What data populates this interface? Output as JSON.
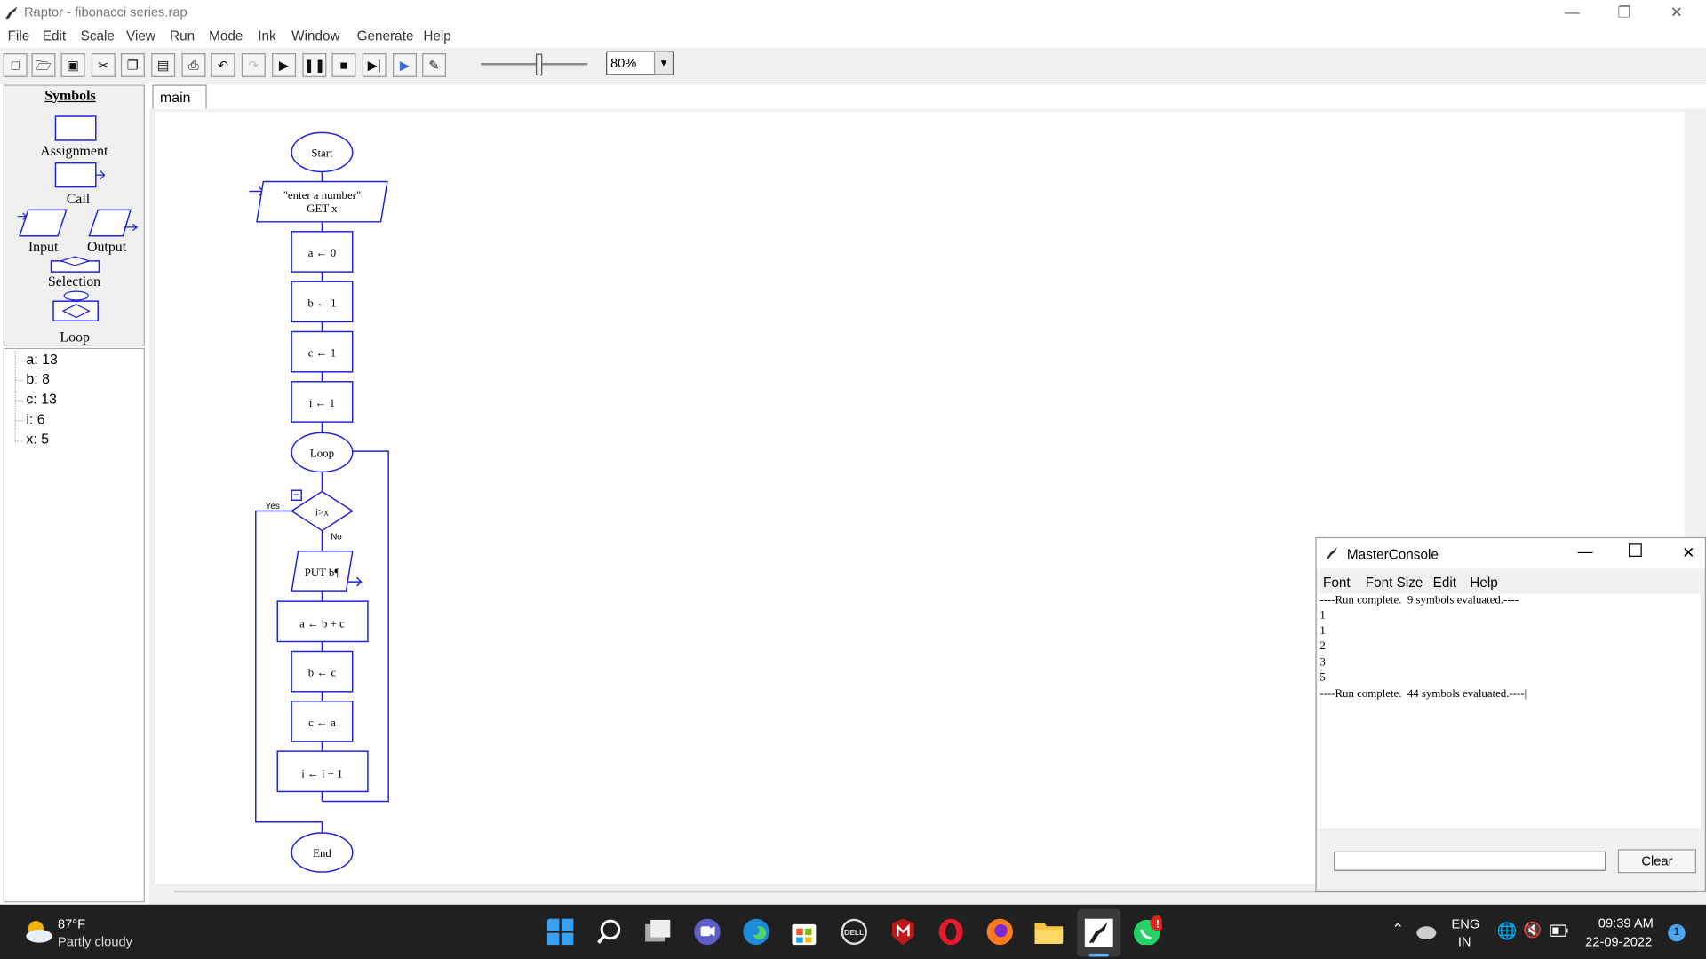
{
  "window": {
    "title": "Raptor - fibonacci series.rap",
    "minimize": "—",
    "restore": "❐",
    "close": "✕"
  },
  "menu": [
    "File",
    "Edit",
    "Scale",
    "View",
    "Run",
    "Mode",
    "Ink",
    "Window",
    "Generate",
    "Help"
  ],
  "toolbar": {
    "zoom": "80%",
    "speed_slider": 0.55
  },
  "symbols": {
    "header": "Symbols",
    "assignment": "Assignment",
    "call": "Call",
    "input": "Input",
    "output": "Output",
    "selection": "Selection",
    "loop": "Loop"
  },
  "variables": [
    "a: 13",
    "b: 8",
    "c: 13",
    "i: 6",
    "x: 5"
  ],
  "tab": "main",
  "flowchart": {
    "start": "Start",
    "input_prompt": "\"enter a number\"",
    "input_get": "GET x",
    "a0": "a ← 0",
    "b1": "b ← 1",
    "c1": "c ← 1",
    "i1": "i ← 1",
    "loop": "Loop",
    "cond": "i>x",
    "yes": "Yes",
    "no": "No",
    "put": "PUT b¶",
    "abc": "a ← b + c",
    "bc": "b ← c",
    "ca": "c ← a",
    "ii": "i ← i + 1",
    "end": "End"
  },
  "console": {
    "title": "MasterConsole",
    "menu": [
      "Font",
      "Font Size",
      "Edit",
      "Help"
    ],
    "lines": [
      "----Run complete.  9 symbols evaluated.----",
      "1",
      "1",
      "2",
      "3",
      "5",
      "----Run complete.  44 symbols evaluated.----|"
    ],
    "clear": "Clear"
  },
  "taskbar": {
    "temp": "87°F",
    "weather": "Partly cloudy",
    "lang1": "ENG",
    "lang2": "IN",
    "time": "09:39 AM",
    "date": "22-09-2022",
    "notif": "1"
  }
}
